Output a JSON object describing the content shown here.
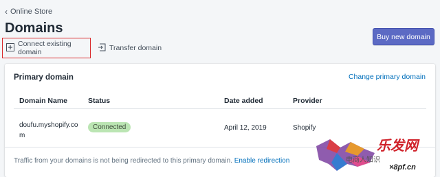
{
  "breadcrumb": {
    "label": "Online Store",
    "icon": "chevron-left-icon"
  },
  "page": {
    "title": "Domains"
  },
  "actions": {
    "connect_label": "Connect existing domain",
    "transfer_label": "Transfer domain",
    "buy_label": "Buy new domain"
  },
  "card": {
    "title": "Primary domain",
    "change_link": "Change primary domain",
    "columns": [
      "Domain Name",
      "Status",
      "Date added",
      "Provider"
    ],
    "rows": [
      {
        "domain": "doufu.myshopify.com",
        "status": "Connected",
        "date": "April 12, 2019",
        "provider": "Shopify"
      }
    ],
    "footer_text": "Traffic from your domains is not being redirected to this primary domain.",
    "footer_link": "Enable redirection"
  },
  "watermark": {
    "brand": "乐发网",
    "caption": "电商人知识",
    "site": "×8pf.cn"
  },
  "colors": {
    "accent": "#5c6ac4",
    "link": "#006fbb",
    "badge_success": "#bbe5b3",
    "highlight": "#d9292b"
  }
}
